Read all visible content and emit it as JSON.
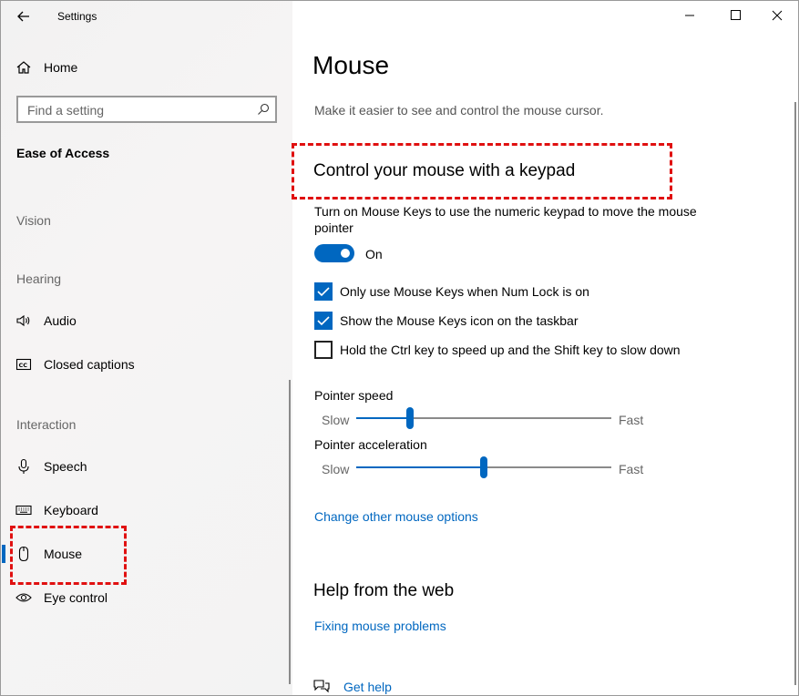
{
  "window": {
    "title": "Settings"
  },
  "sidebar": {
    "home": "Home",
    "search_placeholder": "Find a setting",
    "section": "Ease of Access",
    "groups": {
      "vision": "Vision",
      "hearing": "Hearing",
      "interaction": "Interaction"
    },
    "items": {
      "audio": "Audio",
      "closed_captions": "Closed captions",
      "speech": "Speech",
      "keyboard": "Keyboard",
      "mouse": "Mouse",
      "eye_control": "Eye control"
    },
    "selected": "Mouse"
  },
  "main": {
    "title": "Mouse",
    "description": "Make it easier to see and control the mouse cursor.",
    "section_title": "Control your mouse with a keypad",
    "mouse_keys_desc": "Turn on Mouse Keys to use the numeric keypad to move the mouse pointer",
    "toggle": {
      "state_label": "On",
      "on": true
    },
    "checkboxes": [
      {
        "label": "Only use Mouse Keys when Num Lock is on",
        "checked": true
      },
      {
        "label": "Show the Mouse Keys icon on the taskbar",
        "checked": true
      },
      {
        "label": "Hold the Ctrl key to speed up and the Shift key to slow down",
        "checked": false
      }
    ],
    "pointer_speed": {
      "label": "Pointer speed",
      "min_label": "Slow",
      "max_label": "Fast",
      "value_fraction": 0.21
    },
    "pointer_acceleration": {
      "label": "Pointer acceleration",
      "min_label": "Slow",
      "max_label": "Fast",
      "value_fraction": 0.5
    },
    "link_change_options": "Change other mouse options",
    "help_title": "Help from the web",
    "link_fixing": "Fixing mouse problems",
    "link_get_help": "Get help"
  },
  "colors": {
    "accent": "#0067c0",
    "highlight": "#e01010",
    "sidebar_bg": "#f2f2f2"
  },
  "icons": [
    "back-arrow-icon",
    "home-icon",
    "search-icon",
    "speaker-icon",
    "closed-captions-icon",
    "microphone-icon",
    "keyboard-icon",
    "mouse-icon",
    "eye-icon",
    "minimize-icon",
    "maximize-icon",
    "close-icon",
    "help-chat-icon"
  ]
}
